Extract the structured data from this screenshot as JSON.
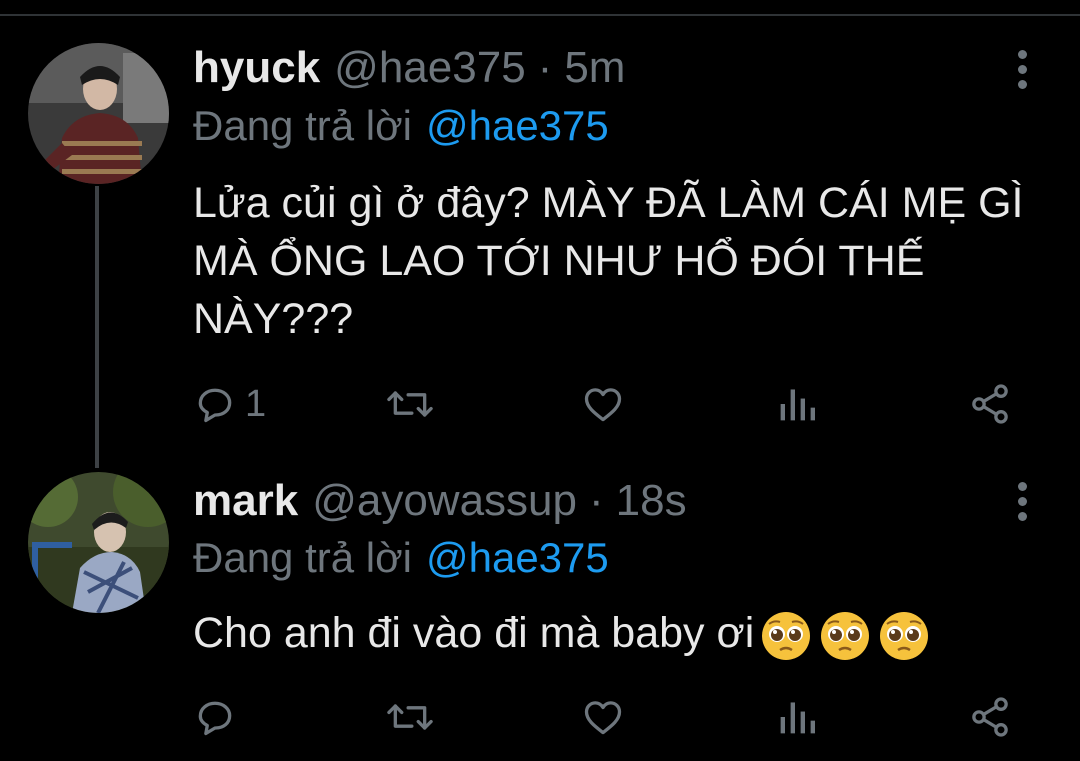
{
  "tweets": [
    {
      "display_name": "hyuck",
      "handle": "@hae375",
      "separator": "·",
      "time": "5m",
      "reply_prefix": "Đang trả lời",
      "reply_to": "@hae375",
      "text": "Lửa củi gì ở đây? MÀY ĐÃ LÀM CÁI MẸ GÌ MÀ ỔNG LAO TỚI NHƯ HỔ ĐÓI THẾ NÀY???",
      "reply_count": "1",
      "avatar_icon": "profile-photo"
    },
    {
      "display_name": "mark",
      "handle": "@ayowassup",
      "separator": "·",
      "time": "18s",
      "reply_prefix": "Đang trả lời",
      "reply_to": "@hae375",
      "text": "Cho anh đi vào đi mà baby ơi",
      "emoji": [
        "pleading-face-emoji",
        "pleading-face-emoji",
        "pleading-face-emoji"
      ],
      "reply_count": "",
      "avatar_icon": "profile-photo"
    }
  ],
  "colors": {
    "background": "#000000",
    "primary_text": "#e8e8e8",
    "secondary_text": "#6e767d",
    "accent": "#1d9bf0",
    "thread_line": "#3d4145"
  },
  "action_icons": [
    "reply-icon",
    "retweet-icon",
    "like-icon",
    "analytics-icon",
    "share-icon"
  ]
}
